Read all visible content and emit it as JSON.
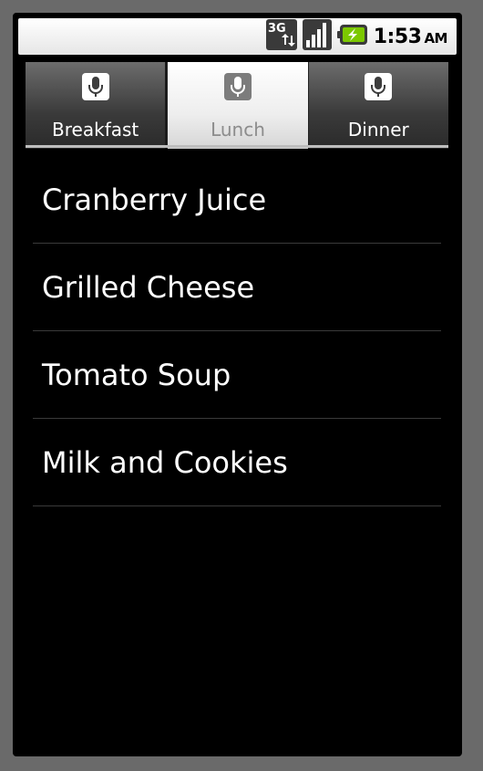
{
  "status_bar": {
    "network_label": "3G",
    "time": "1:53",
    "ampm": "AM",
    "icons": [
      "3g-data-icon",
      "signal-strength-icon",
      "battery-charging-icon"
    ]
  },
  "tabs": [
    {
      "label": "Breakfast",
      "icon": "microphone-icon",
      "selected": false
    },
    {
      "label": "Lunch",
      "icon": "microphone-icon",
      "selected": true
    },
    {
      "label": "Dinner",
      "icon": "microphone-icon",
      "selected": false
    }
  ],
  "list": {
    "items": [
      {
        "label": "Cranberry Juice"
      },
      {
        "label": "Grilled Cheese"
      },
      {
        "label": "Tomato Soup"
      },
      {
        "label": "Milk and Cookies"
      }
    ]
  },
  "colors": {
    "battery_accent": "#7cc800",
    "selected_tab_text": "#8c8c8c"
  }
}
